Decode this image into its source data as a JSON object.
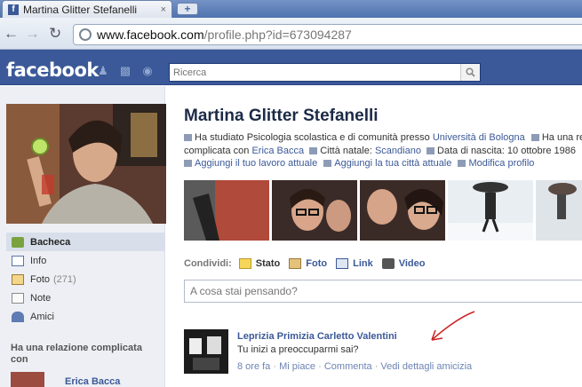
{
  "browser": {
    "tab_title": "Martina Glitter Stefanelli",
    "tab_close": "×",
    "new_tab": "+",
    "url_host": "www.facebook.com",
    "url_path": "/profile.php?id=673094287"
  },
  "fb": {
    "logo": "facebook",
    "search_placeholder": "Ricerca"
  },
  "left": {
    "nav": [
      {
        "label": "Bacheca"
      },
      {
        "label": "Info"
      },
      {
        "label": "Foto",
        "count": "(271)"
      },
      {
        "label": "Note"
      },
      {
        "label": "Amici"
      }
    ],
    "relationship_heading": "Ha una relazione complicata con",
    "relationship_name": "Erica Bacca"
  },
  "profile": {
    "name": "Martina Glitter Stefanelli",
    "line1_prefix": "Ha studiato Psicologia scolastica e di comunità presso ",
    "line1_school": "Università di Bologna",
    "line1_rel": "Ha una rela",
    "line2_prefix": "complicata con ",
    "line2_rel_name": "Erica Bacca",
    "line2_city_label": "Città natale: ",
    "line2_city": "Scandiano",
    "line2_birth": "Data di nascita: 10 ottobre 1986",
    "line3_work": "Aggiungi il tuo lavoro attuale",
    "line3_city": "Aggiungi la tua città attuale",
    "line3_edit": "Modifica profilo"
  },
  "share": {
    "label": "Condividi:",
    "items": [
      "Stato",
      "Foto",
      "Link",
      "Video"
    ],
    "placeholder": "A cosa stai pensando?"
  },
  "story": {
    "author": "Leprizia Primizia Carletto Valentini",
    "text": "Tu inizi a preoccuparmi sai?",
    "time": "8 ore fa",
    "like": "Mi piace",
    "comment": "Commenta",
    "details": "Vedi dettagli amicizia",
    "dot": " · "
  },
  "colors": {
    "fb_blue": "#3b5998",
    "link": "#3b5998",
    "annotation_arrow": "#cc2222"
  }
}
